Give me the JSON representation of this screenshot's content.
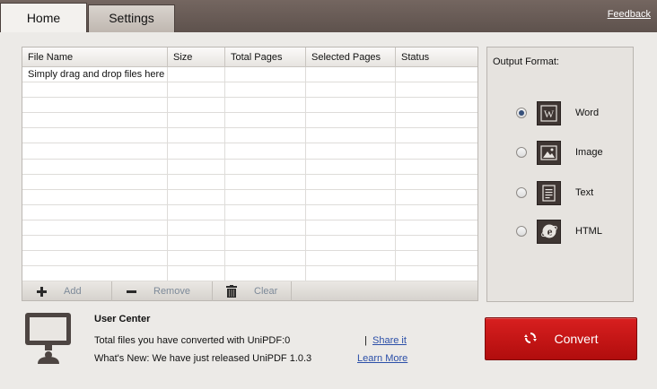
{
  "tabs": {
    "home": "Home",
    "settings": "Settings",
    "feedback": "Feedback"
  },
  "table": {
    "columns": [
      "File Name",
      "Size",
      "Total Pages",
      "Selected Pages",
      "Status"
    ],
    "hint": "Simply drag and drop files here"
  },
  "actions": {
    "add": "Add",
    "remove": "Remove",
    "clear": "Clear"
  },
  "output": {
    "title": "Output Format:",
    "options": [
      {
        "label": "Word",
        "icon": "word-file-icon",
        "selected": true
      },
      {
        "label": "Image",
        "icon": "image-file-icon",
        "selected": false
      },
      {
        "label": "Text",
        "icon": "text-file-icon",
        "selected": false
      },
      {
        "label": "HTML",
        "icon": "html-file-icon",
        "selected": false
      }
    ]
  },
  "user_center": {
    "title": "User Center",
    "converted_text": "Total files you have converted with UniPDF:0",
    "separator": "|",
    "share_label": "Share it",
    "whats_new": "What's New: We have just released UniPDF 1.0.3",
    "learn_more": "Learn More"
  },
  "convert_label": "Convert",
  "colors": {
    "accent": "#c41414",
    "topbar": "#6a5d58",
    "link": "#2b4fa8"
  }
}
